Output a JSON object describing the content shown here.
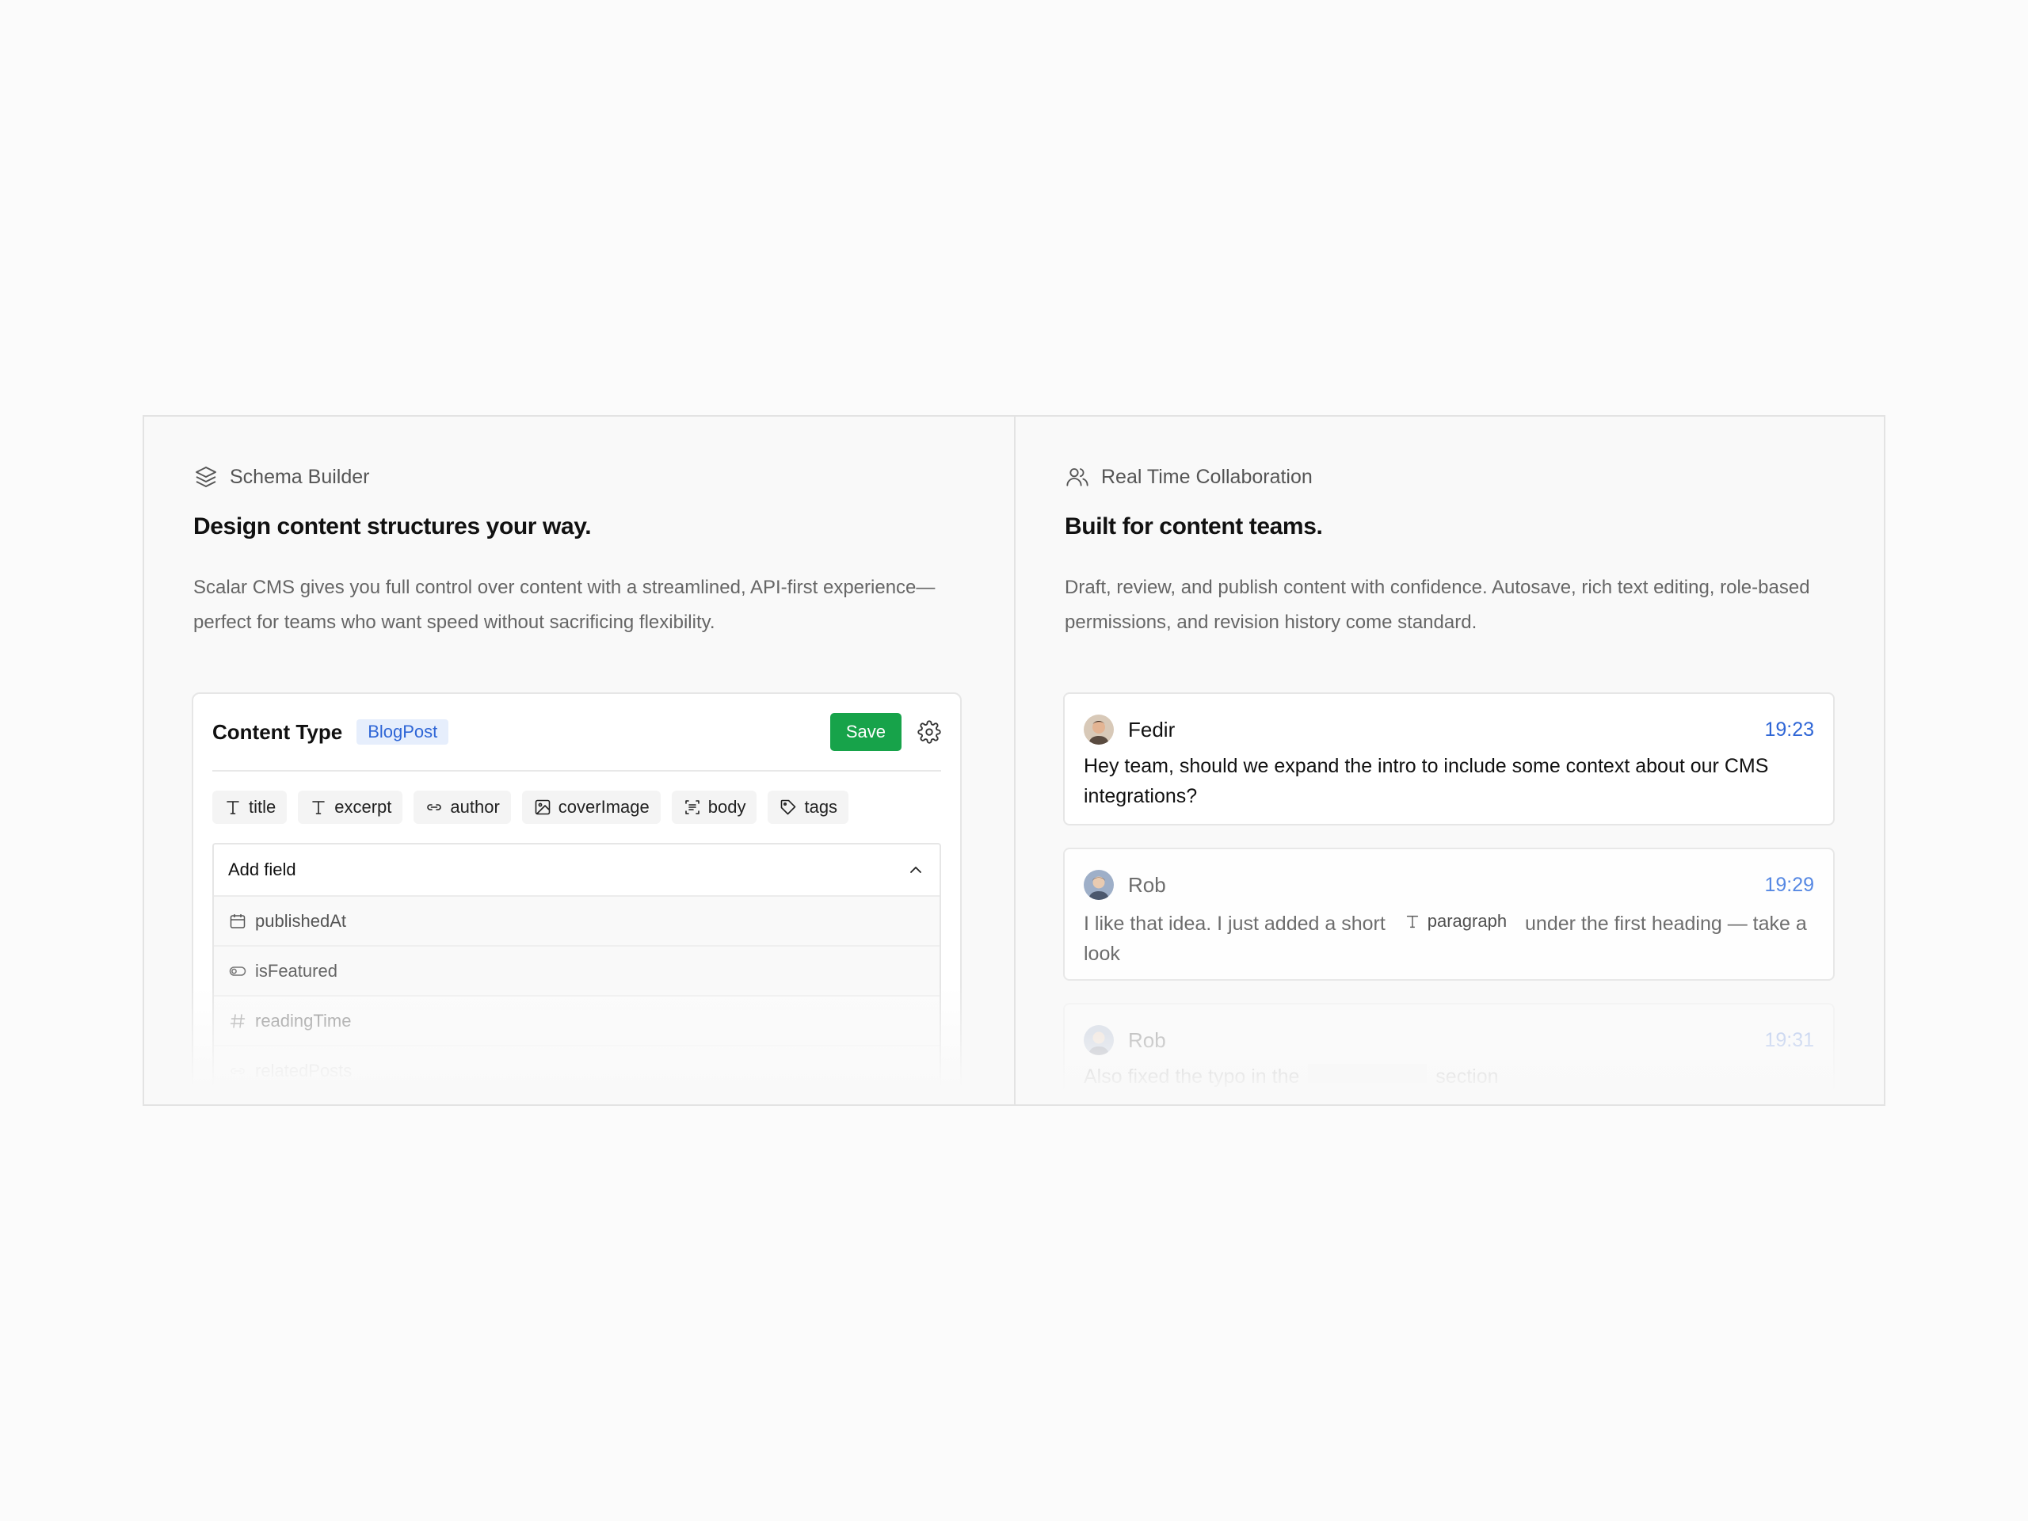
{
  "schema": {
    "eyebrow": "Schema Builder",
    "heading": "Design content structures your way.",
    "description": "Scalar CMS gives you full control over content with a streamlined, API-first experience—perfect for teams who want speed without sacrificing flexibility.",
    "card": {
      "title": "Content Type",
      "badge": "BlogPost",
      "save_label": "Save",
      "fields": [
        {
          "icon": "text-icon",
          "label": "title"
        },
        {
          "icon": "text-icon",
          "label": "excerpt"
        },
        {
          "icon": "link-icon",
          "label": "author"
        },
        {
          "icon": "image-icon",
          "label": "coverImage"
        },
        {
          "icon": "rich-text-icon",
          "label": "body"
        },
        {
          "icon": "tag-icon",
          "label": "tags"
        }
      ],
      "add_field": {
        "label": "Add field",
        "options": [
          {
            "icon": "calendar-icon",
            "label": "publishedAt"
          },
          {
            "icon": "toggle-icon",
            "label": "isFeatured"
          },
          {
            "icon": "hash-icon",
            "label": "readingTime"
          },
          {
            "icon": "link-icon",
            "label": "relatedPosts"
          }
        ]
      }
    }
  },
  "collab": {
    "eyebrow": "Real Time Collaboration",
    "heading": "Built for content teams.",
    "description": "Draft, review, and publish content with confidence. Autosave, rich text editing, role-based permissions, and revision history come standard.",
    "messages": [
      {
        "author": "Fedir",
        "time": "19:23",
        "text": "Hey team, should we expand the intro to include some context about our CMS integrations?"
      },
      {
        "author": "Rob",
        "time": "19:29",
        "text_before": "I like that idea. I just added a short",
        "chip": "paragraph",
        "text_after": "under the first heading — take a look"
      },
      {
        "author": "Rob",
        "time": "19:31",
        "text_before": "Also fixed the typo in the",
        "text_after": "section"
      }
    ]
  },
  "colors": {
    "accent_blue": "#2f66d6",
    "save_green": "#17a34a",
    "badge_bg": "#e6eefc"
  }
}
